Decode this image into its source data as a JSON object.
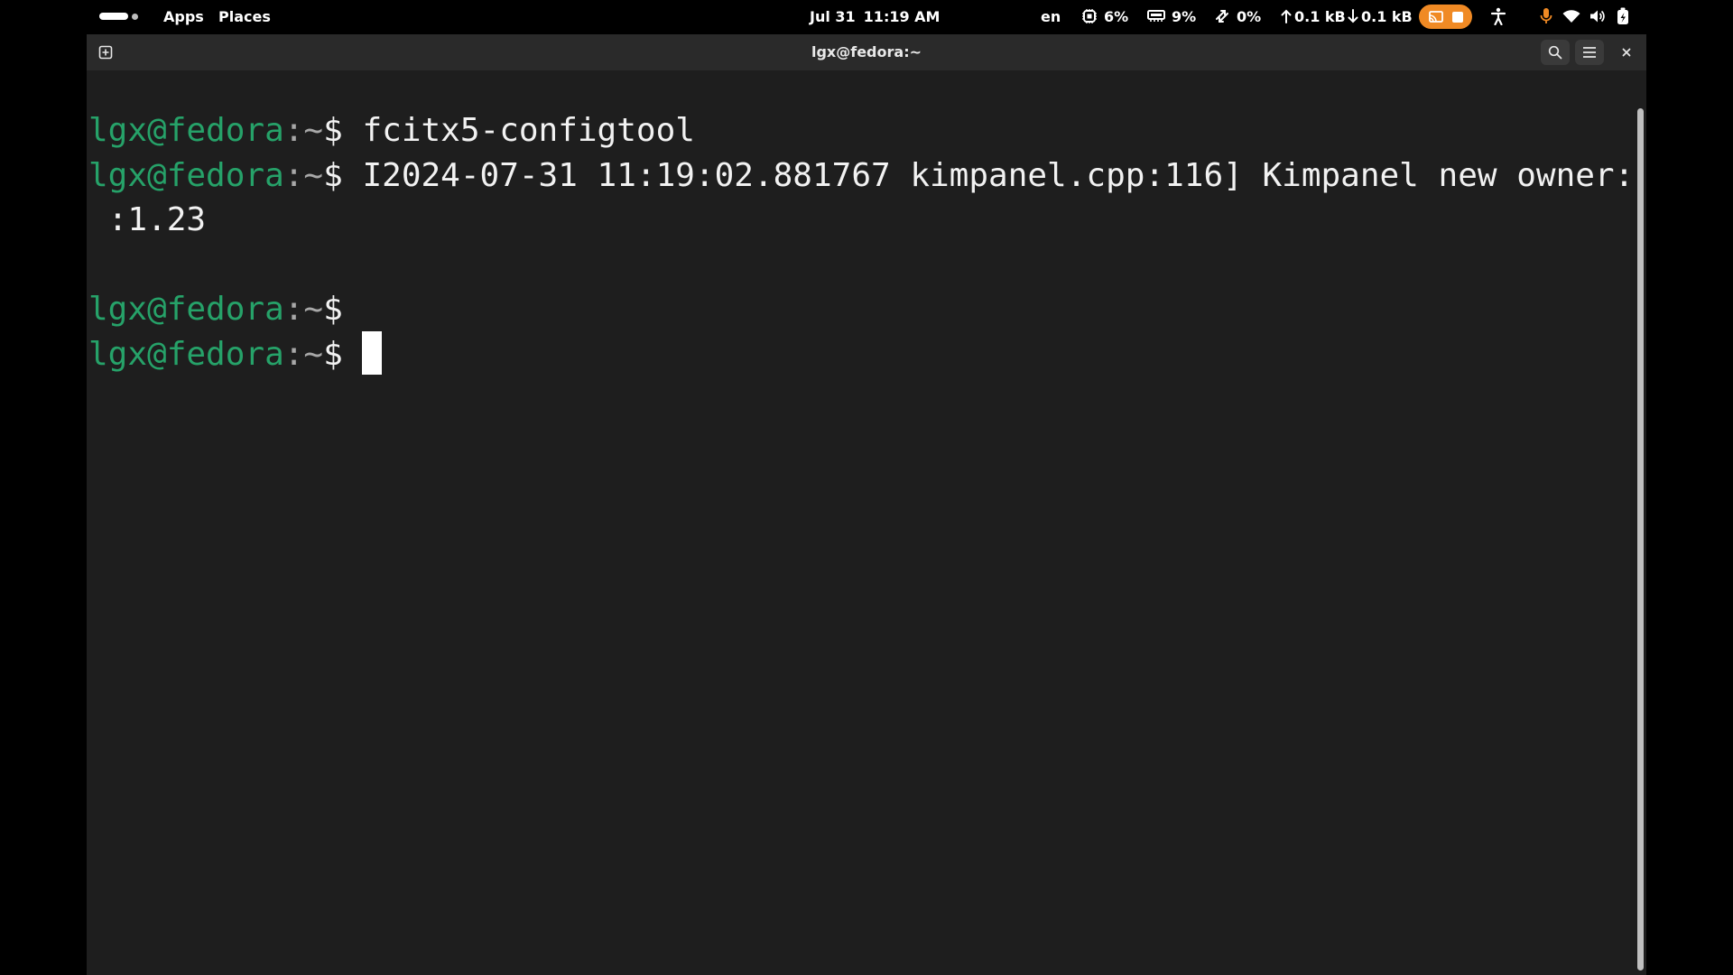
{
  "topbar": {
    "apps_label": "Apps",
    "places_label": "Places",
    "date": "Jul 31",
    "time": "11:19 AM",
    "keyboard_layout": "en",
    "cpu_percent": "6%",
    "memory_percent": "9%",
    "swap_percent": "0%",
    "net_upload": "0.1 kB",
    "net_download": "0.1 kB",
    "record_accent": "#f08a24",
    "mic_accent": "#f08a24",
    "icons": [
      "activities-indicator",
      "cpu-icon",
      "memory-icon",
      "swap-icon",
      "upload-arrow-icon",
      "download-arrow-icon",
      "screencast-icon",
      "stop-icon",
      "accessibility-icon",
      "microphone-icon",
      "wifi-icon",
      "volume-icon",
      "power-icon"
    ]
  },
  "window": {
    "title": "lgx@fedora:~",
    "icons": [
      "new-tab-icon",
      "search-icon",
      "hamburger-menu-icon",
      "close-icon"
    ]
  },
  "terminal": {
    "user_host": "lgx@fedora",
    "path": ":~",
    "prompt_symbol": "$",
    "user_color": "#26a269",
    "lines": [
      {
        "prompt": true,
        "command": " fcitx5-configtool"
      },
      {
        "prompt": true,
        "command": " I2024-07-31 11:19:02.881767 kimpanel.cpp:116] Kimpanel new owner:"
      },
      {
        "prompt": false,
        "command": " :1.23"
      },
      {
        "prompt": true,
        "command": ""
      },
      {
        "prompt": true,
        "command": " ",
        "cursor": true
      }
    ]
  }
}
